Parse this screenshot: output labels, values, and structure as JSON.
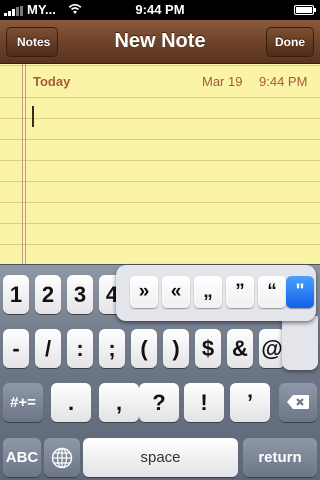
{
  "status_bar": {
    "carrier": "MY...",
    "time": "9:44 PM",
    "battery_level": 1.0
  },
  "nav": {
    "back_label": "Notes",
    "title": "New Note",
    "done_label": "Done"
  },
  "note": {
    "day": "Today",
    "date": "Mar 19",
    "time": "9:44 PM",
    "body": ""
  },
  "keyboard": {
    "row1": [
      "1",
      "2",
      "3",
      "4"
    ],
    "row2": [
      "-",
      "/",
      ":",
      ";",
      "(",
      ")",
      "$",
      "&",
      "@"
    ],
    "row3": [
      ".",
      ",",
      "?",
      "!",
      "’"
    ],
    "shift_label": "#+=",
    "abc_label": "ABC",
    "space_label": "space",
    "return_label": "return",
    "popup": [
      "»",
      "«",
      "„",
      "”",
      "“",
      "\""
    ],
    "popup_selected": "\""
  },
  "colors": {
    "nav_brown": "#6c4128",
    "paper_yellow": "#fbf4a6",
    "note_text": "#a65a37",
    "selected_blue": "#1160e8"
  },
  "icons": {
    "signal": "signal-bars-icon",
    "wifi": "wifi-icon",
    "battery": "battery-icon",
    "globe": "globe-icon",
    "delete": "delete-backspace-icon"
  }
}
